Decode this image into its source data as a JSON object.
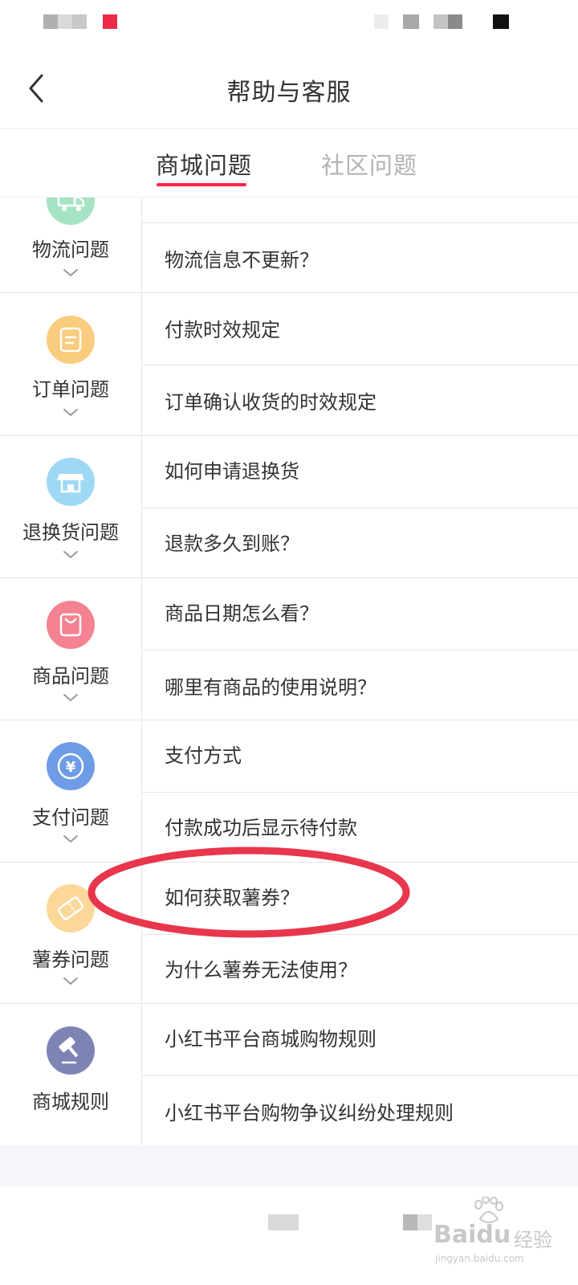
{
  "header": {
    "title": "帮助与客服"
  },
  "tabs": [
    {
      "label": "商城问题",
      "active": true
    },
    {
      "label": "社区问题",
      "active": false
    }
  ],
  "categories": [
    {
      "label": "物流问题",
      "icon": "truck-icon",
      "color": "#a6e3c4",
      "questions": [
        "物流信息不更新？"
      ]
    },
    {
      "label": "订单问题",
      "icon": "order-icon",
      "color": "#f9cc7e",
      "questions": [
        "付款时效规定",
        "订单确认收货的时效规定"
      ]
    },
    {
      "label": "退换货问题",
      "icon": "store-icon",
      "color": "#9fd8f5",
      "questions": [
        "如何申请退换货",
        "退款多久到账？"
      ]
    },
    {
      "label": "商品问题",
      "icon": "shopping-bag-icon",
      "color": "#f58292",
      "questions": [
        "商品日期怎么看？",
        "哪里有商品的使用说明？"
      ]
    },
    {
      "label": "支付问题",
      "icon": "yen-icon",
      "color": "#6f9ce6",
      "questions": [
        "支付方式",
        "付款成功后显示待付款"
      ]
    },
    {
      "label": "薯券问题",
      "icon": "coupon-icon",
      "color": "#fbd79a",
      "questions": [
        "如何获取薯券？",
        "为什么薯券无法使用？"
      ]
    },
    {
      "label": "商城规则",
      "icon": "gavel-icon",
      "color": "#7d84b3",
      "questions": [
        "小红书平台商城购物规则",
        "小红书平台购物争议纠纷处理规则"
      ]
    }
  ],
  "watermark": {
    "brand": "Baidu",
    "cn": "经验",
    "url": "jingyan.baidu.com"
  },
  "colors": {
    "accent": "#ff2442",
    "annotation": "#e8364c"
  }
}
